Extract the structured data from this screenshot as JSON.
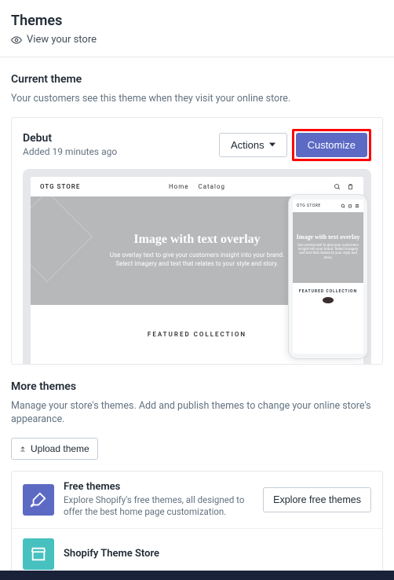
{
  "header": {
    "title": "Themes",
    "view_store": "View your store"
  },
  "current": {
    "section_title": "Current theme",
    "section_desc": "Your customers see this theme when they visit your online store.",
    "theme_name": "Debut",
    "theme_meta": "Added 19 minutes ago",
    "actions_label": "Actions",
    "customize_label": "Customize"
  },
  "preview": {
    "brand": "OTG STORE",
    "nav_home": "Home",
    "nav_catalog": "Catalog",
    "hero_title": "Image with text overlay",
    "hero_sub": "Use overlay text to give your customers insight into your brand. Select imagery and text that relates to your style and story.",
    "featured": "FEATURED COLLECTION",
    "mobile_hero_title": "Image with text overlay",
    "mobile_hero_sub": "Use overlay text to give your customers insight into your brand. Select imagery and text that relates to your style and story."
  },
  "more": {
    "section_title": "More themes",
    "section_desc": "Manage your store's themes. Add and publish themes to change your online store's appearance.",
    "upload_label": "Upload theme",
    "rows": [
      {
        "title": "Free themes",
        "desc": "Explore Shopify's free themes, all designed to offer the best home page customization.",
        "action": "Explore free themes"
      },
      {
        "title": "Shopify Theme Store",
        "desc": "",
        "action": ""
      }
    ]
  }
}
